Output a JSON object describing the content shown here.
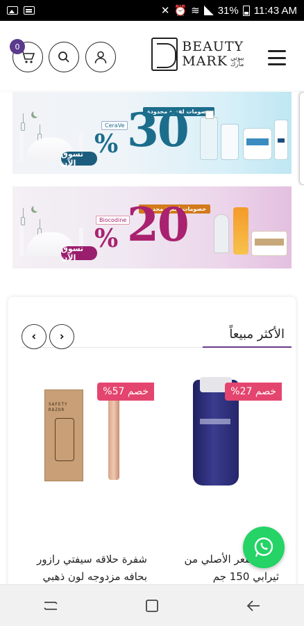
{
  "status_bar": {
    "battery": "31%",
    "time": "11:43 AM"
  },
  "header": {
    "cart_count": "0",
    "logo_line1": "BEAUTY",
    "logo_line2": "MARK",
    "logo_arabic": "بيوتي مارك"
  },
  "banners": [
    {
      "cta": "تسوق الآن",
      "discount_number": "30",
      "percent_sign": "%",
      "tag": "خصومات لفترة محدودة",
      "brand": "CeraVe"
    },
    {
      "cta": "تسوق الآن",
      "discount_number": "20",
      "percent_sign": "%",
      "tag": "خصومات لفترة محدودة",
      "brand": "Biocodine"
    }
  ],
  "best_sellers": {
    "title": "الأكثر مبيعاً",
    "products": [
      {
        "discount": "خصم 27%",
        "name": "فرد الشعر الأصلي من ثيرابي 150 جم"
      },
      {
        "discount": "خصم 57%",
        "name": "شفرة حلاقه سيفتي رازور بحافه مزدوجه لون ذهبي"
      }
    ],
    "razor_box_label": "SAFETY RAZOR"
  },
  "colors": {
    "accent": "#6b3b8a",
    "badge": "#5b3a8c",
    "discount": "#e4456f",
    "whatsapp": "#25d366"
  }
}
